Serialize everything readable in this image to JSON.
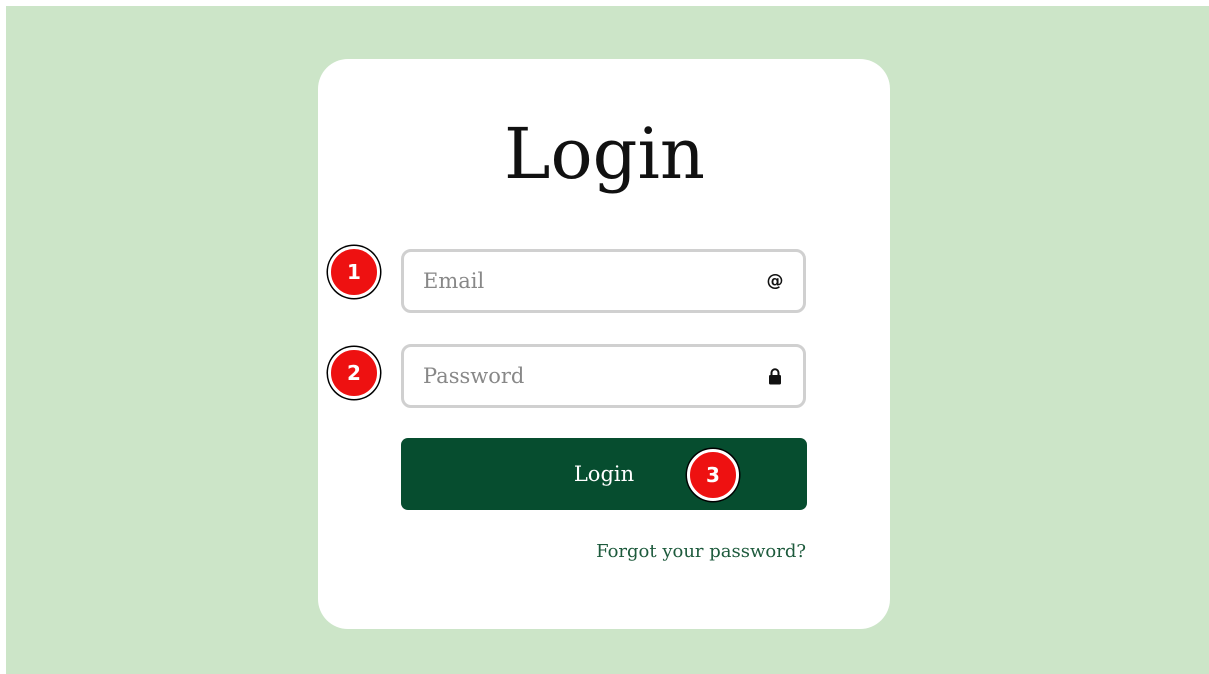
{
  "login_form": {
    "title": "Login",
    "email": {
      "value": "",
      "placeholder": "Email",
      "icon": "at-icon"
    },
    "password": {
      "value": "",
      "placeholder": "Password",
      "icon": "lock-icon"
    },
    "submit_label": "Login",
    "forgot_link": "Forgot your password?"
  },
  "annotations": [
    {
      "label": "1",
      "target": "email-field"
    },
    {
      "label": "2",
      "target": "password-field"
    },
    {
      "label": "3",
      "target": "login-button"
    }
  ],
  "colors": {
    "background": "#cce5c8",
    "card": "#ffffff",
    "button": "#064d2f",
    "link": "#1d5a3c",
    "marker": "#ee1111"
  }
}
